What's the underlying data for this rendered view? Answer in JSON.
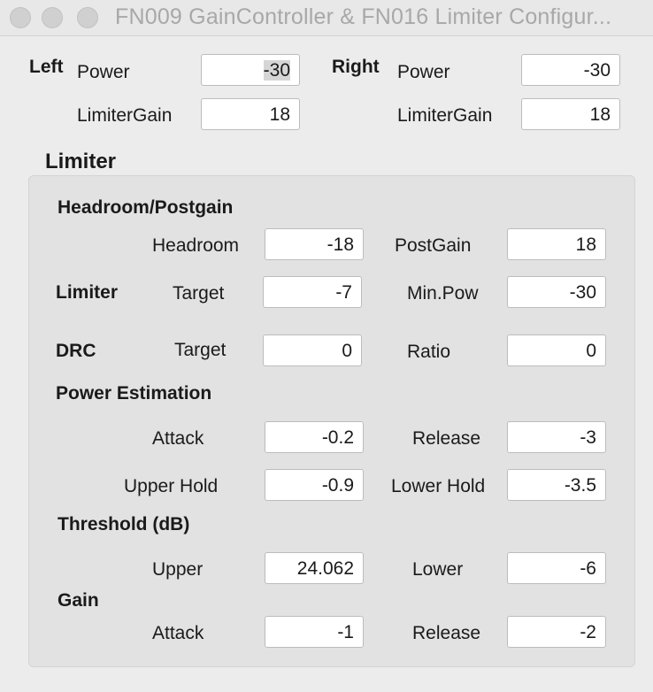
{
  "window": {
    "title": "FN009 GainController & FN016 Limiter Configur..."
  },
  "channels": {
    "left": {
      "label": "Left",
      "power_label": "Power",
      "power_value": "-30",
      "limitergain_label": "LimiterGain",
      "limitergain_value": "18"
    },
    "right": {
      "label": "Right",
      "power_label": "Power",
      "power_value": "-30",
      "limitergain_label": "LimiterGain",
      "limitergain_value": "18"
    }
  },
  "limiter": {
    "title": "Limiter",
    "headroom_postgain": {
      "title": "Headroom/Postgain",
      "headroom_label": "Headroom",
      "headroom_value": "-18",
      "postgain_label": "PostGain",
      "postgain_value": "18"
    },
    "limiter_row": {
      "title": "Limiter",
      "target_label": "Target",
      "target_value": "-7",
      "minpow_label": "Min.Pow",
      "minpow_value": "-30"
    },
    "drc": {
      "title": "DRC",
      "target_label": "Target",
      "target_value": "0",
      "ratio_label": "Ratio",
      "ratio_value": "0"
    },
    "power_estimation": {
      "title": "Power Estimation",
      "attack_label": "Attack",
      "attack_value": "-0.2",
      "release_label": "Release",
      "release_value": "-3",
      "upper_hold_label": "Upper Hold",
      "upper_hold_value": "-0.9",
      "lower_hold_label": "Lower Hold",
      "lower_hold_value": "-3.5"
    },
    "threshold": {
      "title": "Threshold (dB)",
      "upper_label": "Upper",
      "upper_value": "24.062",
      "lower_label": "Lower",
      "lower_value": "-6"
    },
    "gain": {
      "title": "Gain",
      "attack_label": "Attack",
      "attack_value": "-1",
      "release_label": "Release",
      "release_value": "-2"
    }
  }
}
